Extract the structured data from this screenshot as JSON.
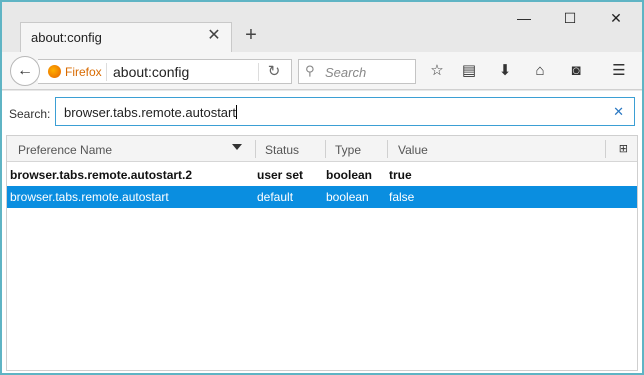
{
  "tab": {
    "title": "about:config"
  },
  "window": {
    "minimize": "—",
    "maximize": "☐",
    "close": "✕"
  },
  "navbar": {
    "identity_label": "Firefox",
    "url": "about:config",
    "search_placeholder": "Search"
  },
  "filter": {
    "label": "Search:",
    "value": "browser.tabs.remote.autostart"
  },
  "table": {
    "columns": [
      "Preference Name",
      "Status",
      "Type",
      "Value"
    ],
    "rows": [
      {
        "name": "browser.tabs.remote.autostart.2",
        "status": "user set",
        "type": "boolean",
        "value": "true"
      },
      {
        "name": "browser.tabs.remote.autostart",
        "status": "default",
        "type": "boolean",
        "value": "false"
      }
    ]
  },
  "colors": {
    "accent": "#5fb4c4",
    "selection": "#0a8ee0",
    "firefox": "#e66000"
  }
}
